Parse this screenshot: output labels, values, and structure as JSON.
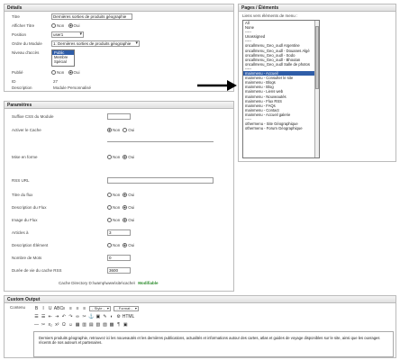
{
  "details": {
    "header": "Détails",
    "fields": {
      "title_label": "Titre",
      "title_value": "Dernières sorties de produits géographie",
      "show_title_label": "Afficher Titre",
      "show_title_no": "Non",
      "show_title_yes": "Oui",
      "position_label": "Position",
      "position_value": "user1",
      "order_label": "Ordre du Module",
      "order_value": "1: Dernières sorties de produits géographie",
      "access_label": "Niveau d'accès",
      "access_options": [
        "Public",
        "Membre",
        "Spécial"
      ],
      "access_selected": "Public",
      "published_label": "Publié",
      "published_no": "Non",
      "published_yes": "Oui",
      "id_label": "ID",
      "id_value": "27",
      "description_label": "Description",
      "description_value": "Module Personnalisé"
    }
  },
  "pages": {
    "header": "Pages / Éléments",
    "caption": "Liens vers éléments de menu :",
    "items": [
      "All",
      "None",
      "-----",
      "Unassigned",
      "-----",
      "oncallmenu_Geo_oudl Argentine",
      "oncallmenu_Geo_oudl - Douanes Algé",
      "oncallmenu_Geo_oudl - Sodo",
      "oncallmenu_Geo_oudl - Bhoutan",
      "oncallmenu_Geo_oudl Salle de photos",
      "-----",
      "mainmenu - Accueil",
      "mainmenu - Consulter le site",
      "mainmenu - Blogs",
      "mainmenu - Blog",
      "mainmenu - Liens web",
      "mainmenu - Nouveautés",
      "mainmenu - Flux RSS",
      "mainmenu - FAQs",
      "mainmenu - Contact",
      "mainmenu - Accueil galerie",
      "-----",
      "othermenu - Site Géographique",
      "othermenu - Forum Géographique"
    ],
    "selected_index": 11
  },
  "params": {
    "header": "Paramètres",
    "rows": [
      {
        "label": "Suffixe CSS du Module",
        "kind": "input",
        "value": ""
      },
      {
        "label": "Activer le Cache",
        "kind": "radio",
        "no": "Non",
        "yes": "Oui",
        "on": "no"
      },
      {
        "label": "Mise en forme",
        "kind": "radio",
        "no": "Non",
        "yes": "Oui",
        "on": "yes"
      },
      {
        "label": "RSS URL",
        "kind": "input",
        "value": ""
      },
      {
        "label": "Titre du flux",
        "kind": "radio",
        "no": "Non",
        "yes": "Oui",
        "on": "yes"
      },
      {
        "label": "Description du Flux",
        "kind": "radio",
        "no": "Non",
        "yes": "Oui",
        "on": "yes"
      },
      {
        "label": "Image du Flux",
        "kind": "radio",
        "no": "Non",
        "yes": "Oui",
        "on": "yes"
      },
      {
        "label": "Articles à",
        "kind": "input",
        "value": "3"
      },
      {
        "label": "Description Élément",
        "kind": "radio",
        "no": "Non",
        "yes": "Oui",
        "on": "yes"
      },
      {
        "label": "Nombre de Mots",
        "kind": "input",
        "value": "0"
      },
      {
        "label": "Durée de vie du cache RSS",
        "kind": "input",
        "value": "3600"
      }
    ],
    "cache_note": "Cache Directory D:\\wamp\\www\\site\\cache\\",
    "cache_status": "Modifiable"
  },
  "custom": {
    "header": "Custom Output",
    "label": "Contenu",
    "toolbar_row1_icons": [
      "B",
      "I",
      "U",
      "ABC",
      "≡",
      "≡",
      "≡",
      "≡"
    ],
    "styles_select": "- Style -",
    "format_select": "- Format -",
    "toolbar_row2_icons": [
      "☰",
      "☰",
      "⇤",
      "⇥",
      "↶",
      "↷",
      "∞",
      "✂",
      "⚓",
      "▣",
      "✎",
      "◐",
      "⚙",
      "HTML"
    ],
    "toolbar_row3_icons": [
      "―",
      "✂",
      "x₂",
      "x²",
      "Ω",
      "☺",
      "▦",
      "▥",
      "▤",
      "▧",
      "▨",
      "▩",
      "¶",
      "▣"
    ],
    "content_text": "Derniers produits géographie, retrouvez ici les nouveautés et les dernières publications, actualités et informations autour des cartes, atlas et guides de voyage disponibles sur le site, ainsi que les ouvrages récents de nos auteurs et partenaires."
  },
  "accent": "#2f5da8"
}
